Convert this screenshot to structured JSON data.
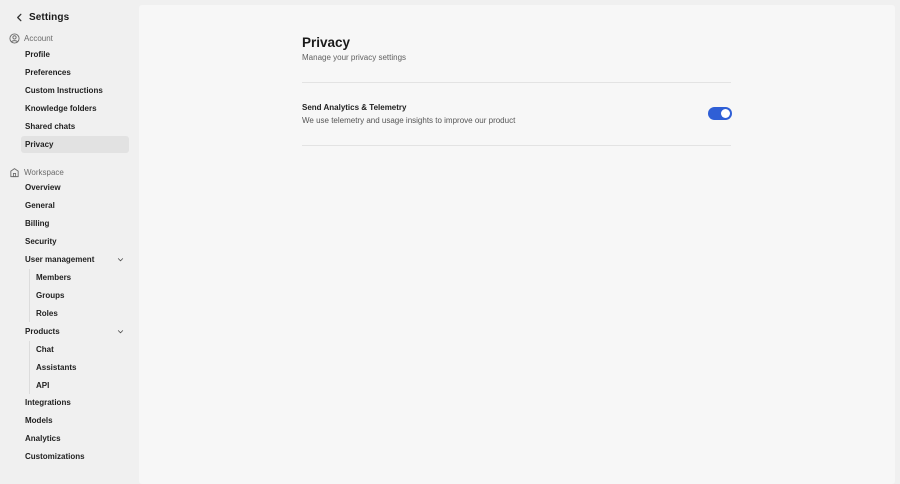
{
  "sidebar": {
    "title": "Settings",
    "account": {
      "label": "Account",
      "items": [
        "Profile",
        "Preferences",
        "Custom Instructions",
        "Knowledge folders",
        "Shared chats",
        "Privacy"
      ]
    },
    "workspace": {
      "label": "Workspace",
      "items": [
        "Overview",
        "General",
        "Billing",
        "Security"
      ],
      "user_management": {
        "label": "User management",
        "children": [
          "Members",
          "Groups",
          "Roles"
        ]
      },
      "products": {
        "label": "Products",
        "children": [
          "Chat",
          "Assistants",
          "API"
        ]
      },
      "bottom_items": [
        "Integrations",
        "Models",
        "Analytics",
        "Customizations"
      ]
    },
    "active_item": "Privacy"
  },
  "main": {
    "title": "Privacy",
    "subtitle": "Manage your privacy settings",
    "setting": {
      "title": "Send Analytics & Telemetry",
      "description": "We use telemetry and usage insights to improve our product",
      "enabled": true
    }
  },
  "colors": {
    "accent": "#2f5fd6",
    "active_bg": "#e2e2e2",
    "panel_bg": "#f7f7f7",
    "app_bg": "#f0f0f0"
  },
  "icons": {
    "back": "chevron-left-icon",
    "account": "user-circle-icon",
    "workspace": "building-icon",
    "expand": "chevron-down-icon"
  }
}
